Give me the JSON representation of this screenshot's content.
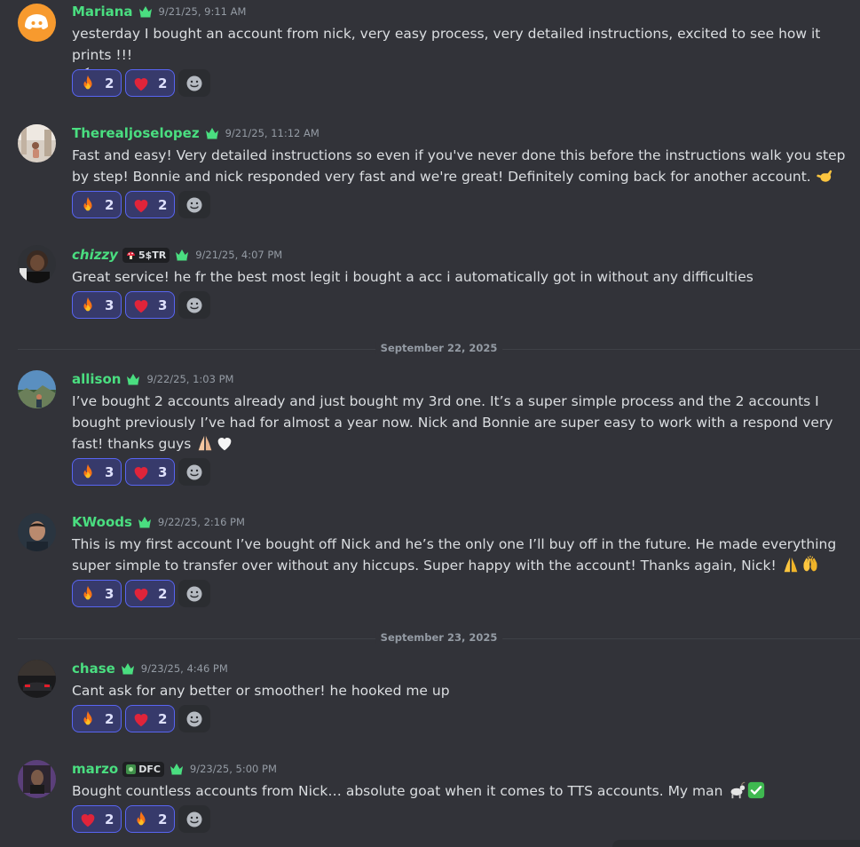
{
  "messages": [
    {
      "username": "Mariana",
      "timestamp": "9/21/25, 9:11 AM",
      "text": "yesterday I bought an account from nick, very easy process, very detailed instructions, excited to see how it prints !!!",
      "reactions": [
        {
          "emoji": "fire-emoji",
          "count": "2"
        },
        {
          "emoji": "heart-emoji",
          "count": "2"
        }
      ]
    },
    {
      "username": "Therealjoselopez",
      "timestamp": "9/21/25, 11:12 AM",
      "text": "Fast and easy! Very detailed instructions so even if you've never done this before the instructions walk you step by step! Bonnie and nick responded very fast and we're great! Definitely coming back for another account.",
      "reactions": [
        {
          "emoji": "fire-emoji",
          "count": "2"
        },
        {
          "emoji": "heart-emoji",
          "count": "2"
        }
      ]
    },
    {
      "username": "chizzy",
      "tag": "5$TR",
      "timestamp": "9/21/25, 4:07 PM",
      "text": "Great service! he fr the best most legit i bought a acc i automatically got in without any difficulties",
      "reactions": [
        {
          "emoji": "fire-emoji",
          "count": "3"
        },
        {
          "emoji": "heart-emoji",
          "count": "3"
        }
      ]
    },
    {
      "username": "allison",
      "timestamp": "9/22/25, 1:03 PM",
      "text": "I’ve bought 2 accounts already and just bought my 3rd one. It’s a super simple process and the 2 accounts I bought previously I’ve had for almost a year now. Nick and Bonnie are super easy to work with a respond very fast! thanks guys",
      "reactions": [
        {
          "emoji": "fire-emoji",
          "count": "3"
        },
        {
          "emoji": "heart-emoji",
          "count": "3"
        }
      ]
    },
    {
      "username": "KWoods",
      "timestamp": "9/22/25, 2:16 PM",
      "text": "This is my first account I’ve bought off Nick and he’s the only one I’ll buy off in the future. He made everything super simple to transfer over without any hiccups. Super happy with the account! Thanks again, Nick!",
      "reactions": [
        {
          "emoji": "fire-emoji",
          "count": "3"
        },
        {
          "emoji": "heart-emoji",
          "count": "2"
        }
      ]
    },
    {
      "username": "chase",
      "timestamp": "9/23/25, 4:46 PM",
      "text": "Cant ask for any better or smoother! he hooked me up",
      "reactions": [
        {
          "emoji": "fire-emoji",
          "count": "2"
        },
        {
          "emoji": "heart-emoji",
          "count": "2"
        }
      ]
    },
    {
      "username": "marzo",
      "tag": "DFC",
      "timestamp": "9/23/25, 5:00 PM",
      "text": "Bought countless accounts from Nick… absolute goat when it comes to TTS accounts. My man",
      "reactions": [
        {
          "emoji": "heart-emoji",
          "count": "2"
        },
        {
          "emoji": "fire-emoji",
          "count": "2"
        }
      ]
    }
  ],
  "dividers": [
    "September 22, 2025",
    "September 23, 2025"
  ],
  "colors": {
    "background": "#323339",
    "username": "#4ade80",
    "reaction_bg": "#373a6b",
    "reaction_border": "#5865f2",
    "timestamp": "#949ba4"
  }
}
